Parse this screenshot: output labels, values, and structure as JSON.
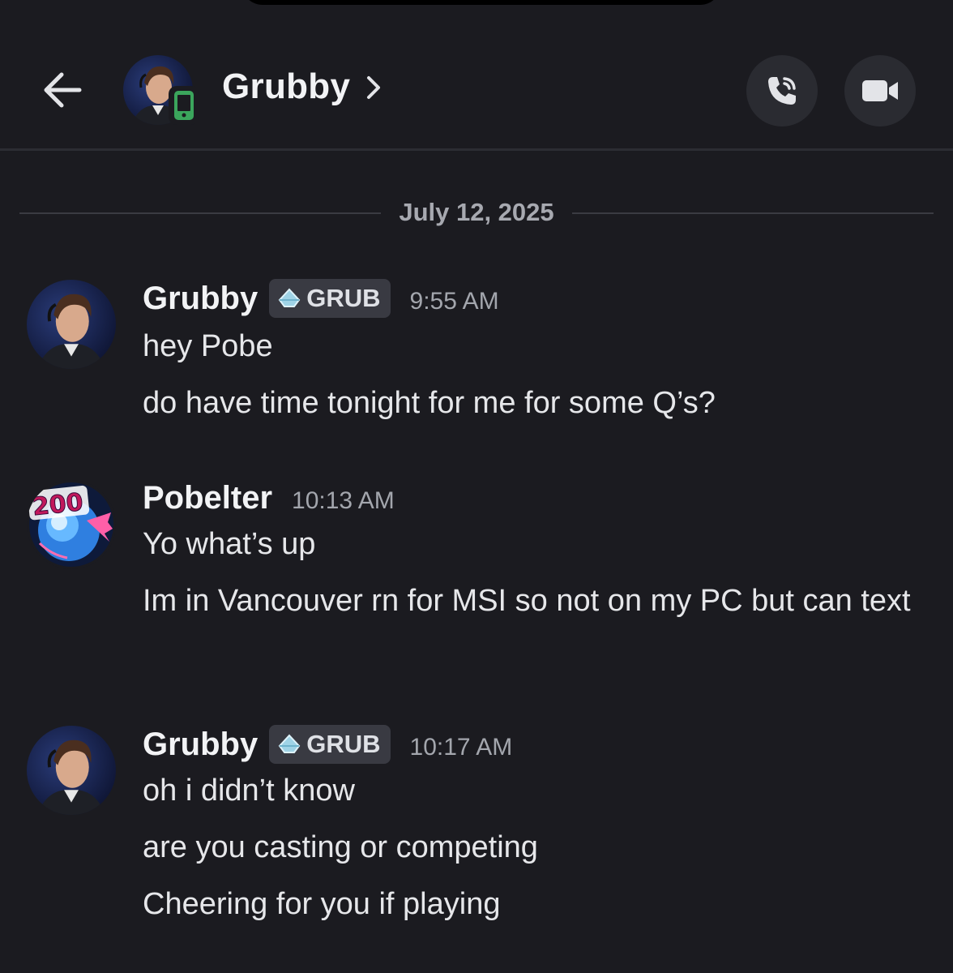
{
  "header": {
    "contact_name": "Grubby",
    "chevron": ">",
    "back_icon": "arrow-left-icon",
    "status_icon": "mobile-phone-icon",
    "status_color": "#3ba55c",
    "call_icon": "phone-call-icon",
    "video_icon": "video-camera-icon"
  },
  "date_divider": "July 12, 2025",
  "messages": [
    {
      "author": "Grubby",
      "tag": "GRUB",
      "time": "9:55 AM",
      "lines": [
        "hey Pobe",
        "do have time tonight for me for some Q’s?"
      ]
    },
    {
      "author": "Pobelter",
      "avatar_text": "200",
      "time": "10:13 AM",
      "lines": [
        "Yo what’s up",
        "Im in Vancouver rn for MSI so not on my PC but can text"
      ]
    },
    {
      "author": "Grubby",
      "tag": "GRUB",
      "time": "10:17 AM",
      "lines": [
        "oh i didn’t know",
        "are you casting or competing",
        "Cheering for you if playing"
      ]
    }
  ],
  "colors": {
    "background": "#1b1b20",
    "button_bg": "#2a2b31",
    "tag_bg": "#393a42",
    "text": "#e6e7ea",
    "muted": "#a3a6ad"
  }
}
